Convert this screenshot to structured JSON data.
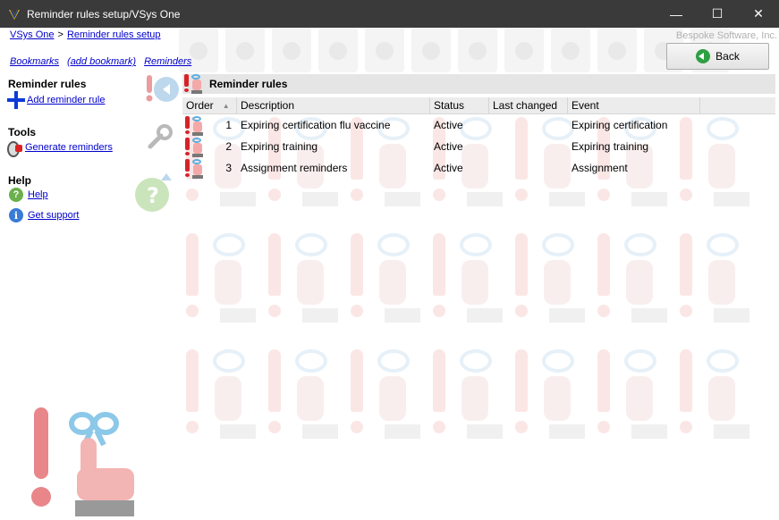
{
  "window": {
    "title": "Reminder rules setup/VSys One",
    "minimize": "—",
    "maximize": "☐",
    "close": "✕"
  },
  "breadcrumb": {
    "root": "VSys One",
    "separator": ">",
    "current": "Reminder rules setup"
  },
  "company": "Bespoke Software, Inc.",
  "bookmarks": {
    "bookmarks": "Bookmarks",
    "add": "(add bookmark)",
    "reminders": "Reminders"
  },
  "back_button": "Back",
  "sidebar": {
    "reminder_rules": {
      "title": "Reminder rules",
      "add": "Add reminder rule"
    },
    "tools": {
      "title": "Tools",
      "generate": "Generate reminders"
    },
    "help": {
      "title": "Help",
      "help": "Help",
      "support": "Get support"
    }
  },
  "panel": {
    "title": "Reminder rules",
    "columns": [
      "Order",
      "Description",
      "Status",
      "Last changed",
      "Event"
    ],
    "rows": [
      {
        "order": "1",
        "description": "Expiring certification flu vaccine",
        "status": "Active",
        "last_changed": "",
        "event": "Expiring certification"
      },
      {
        "order": "2",
        "description": "Expiring training",
        "status": "Active",
        "last_changed": "",
        "event": "Expiring training"
      },
      {
        "order": "3",
        "description": "Assignment reminders",
        "status": "Active",
        "last_changed": "",
        "event": "Assignment"
      }
    ]
  },
  "colors": {
    "titlebar": "#3a3a3a",
    "link": "#0000cc",
    "accent_red": "#d6232a",
    "header_gray": "#e5e5e5"
  },
  "icons": [
    "app-icon",
    "back-arrow-icon",
    "plus-icon",
    "generate-icon",
    "help-icon",
    "info-icon",
    "reminder-icon"
  ]
}
